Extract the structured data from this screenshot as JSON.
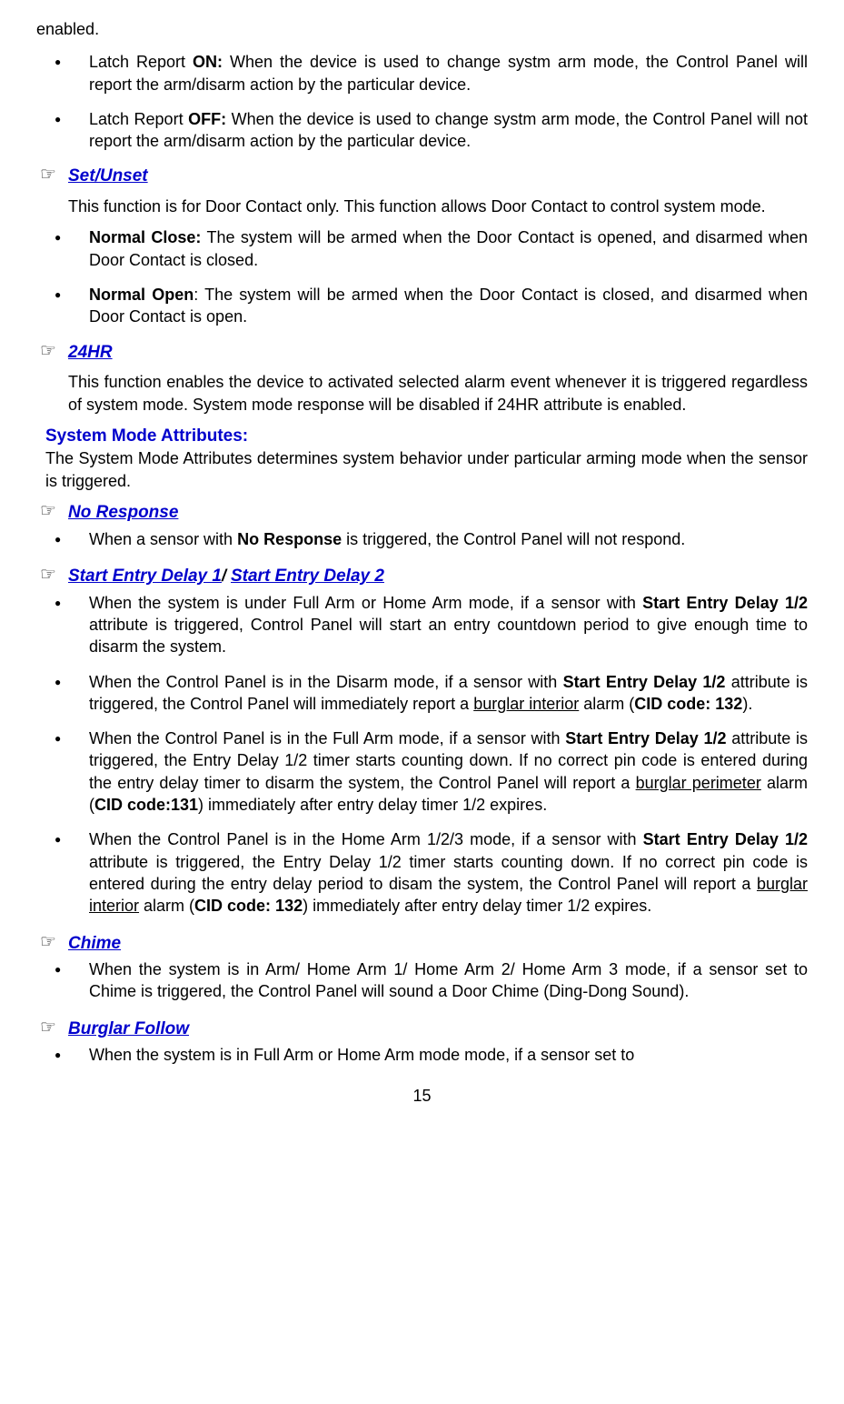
{
  "top": "enabled.",
  "latch": {
    "on_label": "ON:",
    "on_prefix": "Latch Report ",
    "on_text": " When the device is used to change systm arm mode, the Control Panel will report the arm/disarm action by the particular device.",
    "off_label": "OFF:",
    "off_prefix": "Latch Report ",
    "off_text": " When the device is used to change systm arm mode, the Control Panel will not report the arm/disarm action by the particular device."
  },
  "setunset": {
    "title": "Set/Unset",
    "desc": "This function is for Door Contact only. This function allows Door Contact to control system mode.",
    "nc_label": "Normal Close:",
    "nc_text": " The system will be armed when the Door Contact is opened, and disarmed when Door Contact is closed.",
    "no_label": "Normal Open",
    "no_text": ": The system will be armed when the Door Contact is closed, and disarmed when Door Contact is open."
  },
  "hr24": {
    "title": "24HR",
    "desc": "This function enables the device to activated selected alarm event whenever it is triggered regardless of system mode. System mode response will be disabled if 24HR attribute is enabled."
  },
  "sysmode": {
    "header": "System Mode Attributes:",
    "desc": "The System Mode Attributes determines system behavior under particular arming mode when the sensor is triggered."
  },
  "noresponse": {
    "title": "No Response",
    "b1_pre": "When a sensor with ",
    "b1_bold": "No Response",
    "b1_post": " is triggered, the Control Panel will not respond."
  },
  "entrydelay": {
    "title1": "Start Entry Delay 1",
    "slash": "/ ",
    "title2": "Start Entry Delay 2",
    "b1_pre": "When the system is under Full Arm or Home Arm mode, if a sensor with ",
    "b1_bold": "Start Entry Delay 1/2",
    "b1_post": " attribute is triggered, Control Panel will start an entry countdown period to give enough time to disarm the system.",
    "b2_pre": "When the Control Panel is in the Disarm mode, if a sensor with ",
    "b2_bold": "Start Entry Delay 1/2",
    "b2_mid": " attribute is triggered, the Control Panel will immediately report a ",
    "b2_ul": "burglar interior",
    "b2_post1": " alarm (",
    "b2_bold2": "CID code: 132",
    "b2_post2": ").",
    "b3_pre": "When the Control Panel is in the Full Arm mode, if a sensor with ",
    "b3_bold": "Start Entry Delay 1/2",
    "b3_mid": " attribute is triggered, the Entry Delay 1/2 timer starts counting down.  If no correct pin code is entered during the entry delay timer to disarm the system, the Control Panel will report a ",
    "b3_ul": "burglar perimeter",
    "b3_post1": " alarm (",
    "b3_bold2": "CID code:131",
    "b3_post2": ") immediately after entry delay timer 1/2 expires.",
    "b4_pre": "When the Control Panel is in the Home Arm 1/2/3 mode, if a sensor with ",
    "b4_bold": "Start Entry Delay 1/2",
    "b4_mid": " attribute is triggered, the Entry Delay 1/2 timer starts counting down.   If no correct pin code is entered during the entry delay period to disam the system, the Control Panel will report a ",
    "b4_ul": "burglar interior",
    "b4_post1": " alarm (",
    "b4_bold2": "CID code: 132",
    "b4_post2": ") immediately after entry delay timer 1/2 expires."
  },
  "chime": {
    "title": "Chime",
    "b1": "When the system is in Arm/ Home Arm 1/ Home Arm 2/ Home Arm 3 mode, if a sensor set to Chime is triggered, the Control Panel will sound a Door Chime (Ding-Dong Sound)."
  },
  "burglar": {
    "title": "Burglar Follow",
    "b1": "When the system is in Full Arm or Home Arm mode mode, if a sensor set to"
  },
  "page": "15"
}
